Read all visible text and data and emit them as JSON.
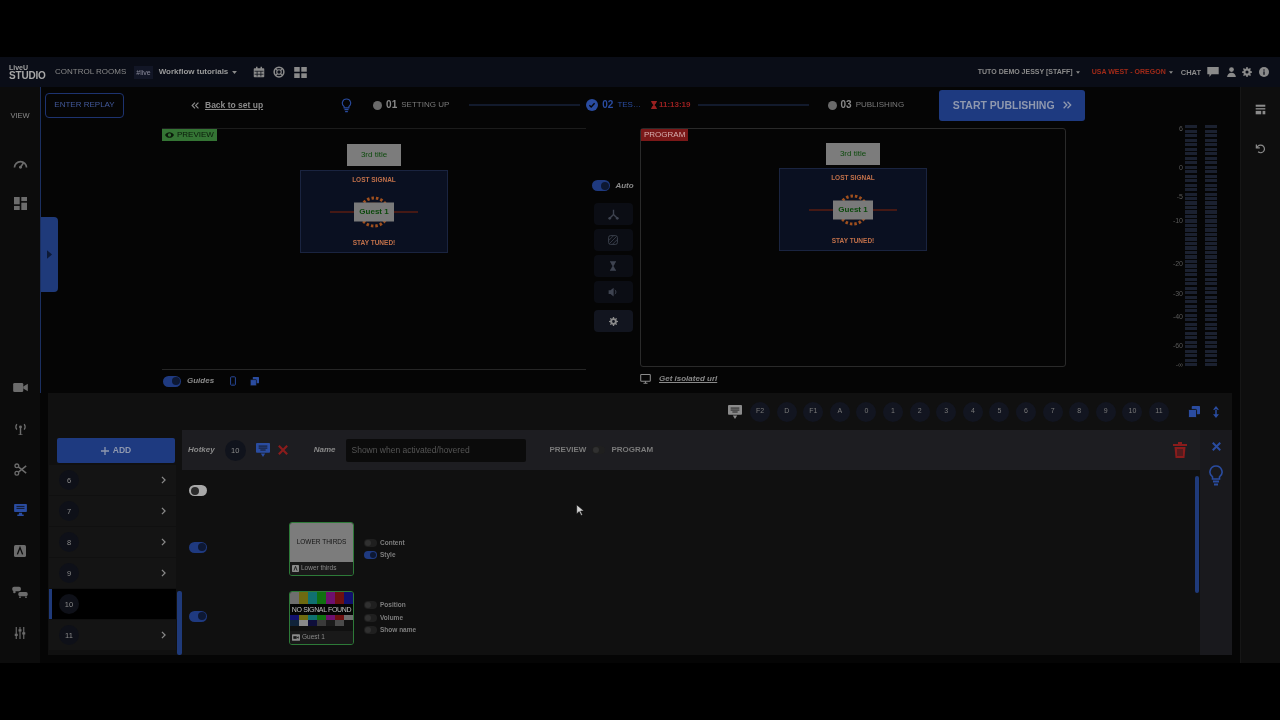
{
  "topbar": {
    "logo_small": "LiveU",
    "logo": "STUDIO",
    "section": "CONTROL ROOMS",
    "workspace_tag": "#live",
    "workspace": "Workflow tutorials",
    "user": "TUTO DEMO JESSY [STAFF]",
    "region": "USA WEST - OREGON",
    "chat": "CHAT"
  },
  "sidebar": {
    "label": "VIEW",
    "items": [
      {
        "selected": false
      },
      {
        "selected": false
      },
      {
        "selected": false
      },
      {
        "selected": false
      },
      {
        "selected": false
      },
      {
        "selected": true
      },
      {
        "selected": false
      },
      {
        "selected": false
      },
      {
        "selected": false
      }
    ]
  },
  "stepbar": {
    "replay_button": "ENTER REPLAY",
    "back_link": "Back to set up",
    "steps": [
      {
        "number": "01",
        "label": "SETTING UP",
        "active": false
      },
      {
        "number": "02",
        "label": "TES…",
        "active": true,
        "timer": "11:13:19"
      },
      {
        "number": "03",
        "label": "PUBLISHING",
        "active": false
      }
    ],
    "publish_button": "START PUBLISHING"
  },
  "preview": {
    "tag": "PREVIEW",
    "overlay_title": "3rd title",
    "signal": {
      "top": "LOST SIGNAL",
      "guest": "Guest 1",
      "bottom": "STAY TUNED!"
    },
    "guides": {
      "label": "Guides",
      "on": true
    }
  },
  "transition": {
    "auto": {
      "label": "Auto",
      "on": true
    }
  },
  "program": {
    "tag": "PROGRAM",
    "overlay_title": "3rd title",
    "signal": {
      "top": "LOST SIGNAL",
      "guest": "Guest 1",
      "bottom": "STAY TUNED!"
    },
    "isolated_link": "Get isolated url"
  },
  "audio_meter": {
    "scale": [
      "6",
      "0",
      "-5",
      "-10",
      "-20",
      "-30",
      "-40",
      "-60",
      "-∞"
    ]
  },
  "hotkeys": [
    "F2",
    "D",
    "F1",
    "A",
    "0",
    "1",
    "2",
    "3",
    "4",
    "5",
    "6",
    "7",
    "8",
    "9",
    "10",
    "11"
  ],
  "editor": {
    "add_button": "ADD",
    "items": [
      {
        "number": "6",
        "selected": false
      },
      {
        "number": "7",
        "selected": false
      },
      {
        "number": "8",
        "selected": false
      },
      {
        "number": "9",
        "selected": false
      },
      {
        "number": "10",
        "selected": true
      },
      {
        "number": "11",
        "selected": false
      }
    ],
    "header": {
      "hotkey_label": "Hotkey",
      "hotkey": "10",
      "name_label": "Name",
      "name_placeholder": "Shown when activated/hovered",
      "preview_label": "PREVIEW",
      "program_label": "PROGRAM",
      "to_program": false
    },
    "layers": [
      {
        "on": false
      },
      {
        "on": true,
        "thumb": {
          "kind": "lower-thirds",
          "title": "LOWER THIRDS",
          "caption": "Lower thirds"
        },
        "options": [
          {
            "label": "Content",
            "on": false
          },
          {
            "label": "Style",
            "on": true
          }
        ]
      },
      {
        "on": true,
        "thumb": {
          "kind": "color-bars",
          "banner": "NO SIGNAL FOUND",
          "caption": "Guest 1"
        },
        "options": [
          {
            "label": "Position",
            "on": false
          },
          {
            "label": "Volume",
            "on": false
          },
          {
            "label": "Show name",
            "on": false
          }
        ]
      }
    ]
  }
}
